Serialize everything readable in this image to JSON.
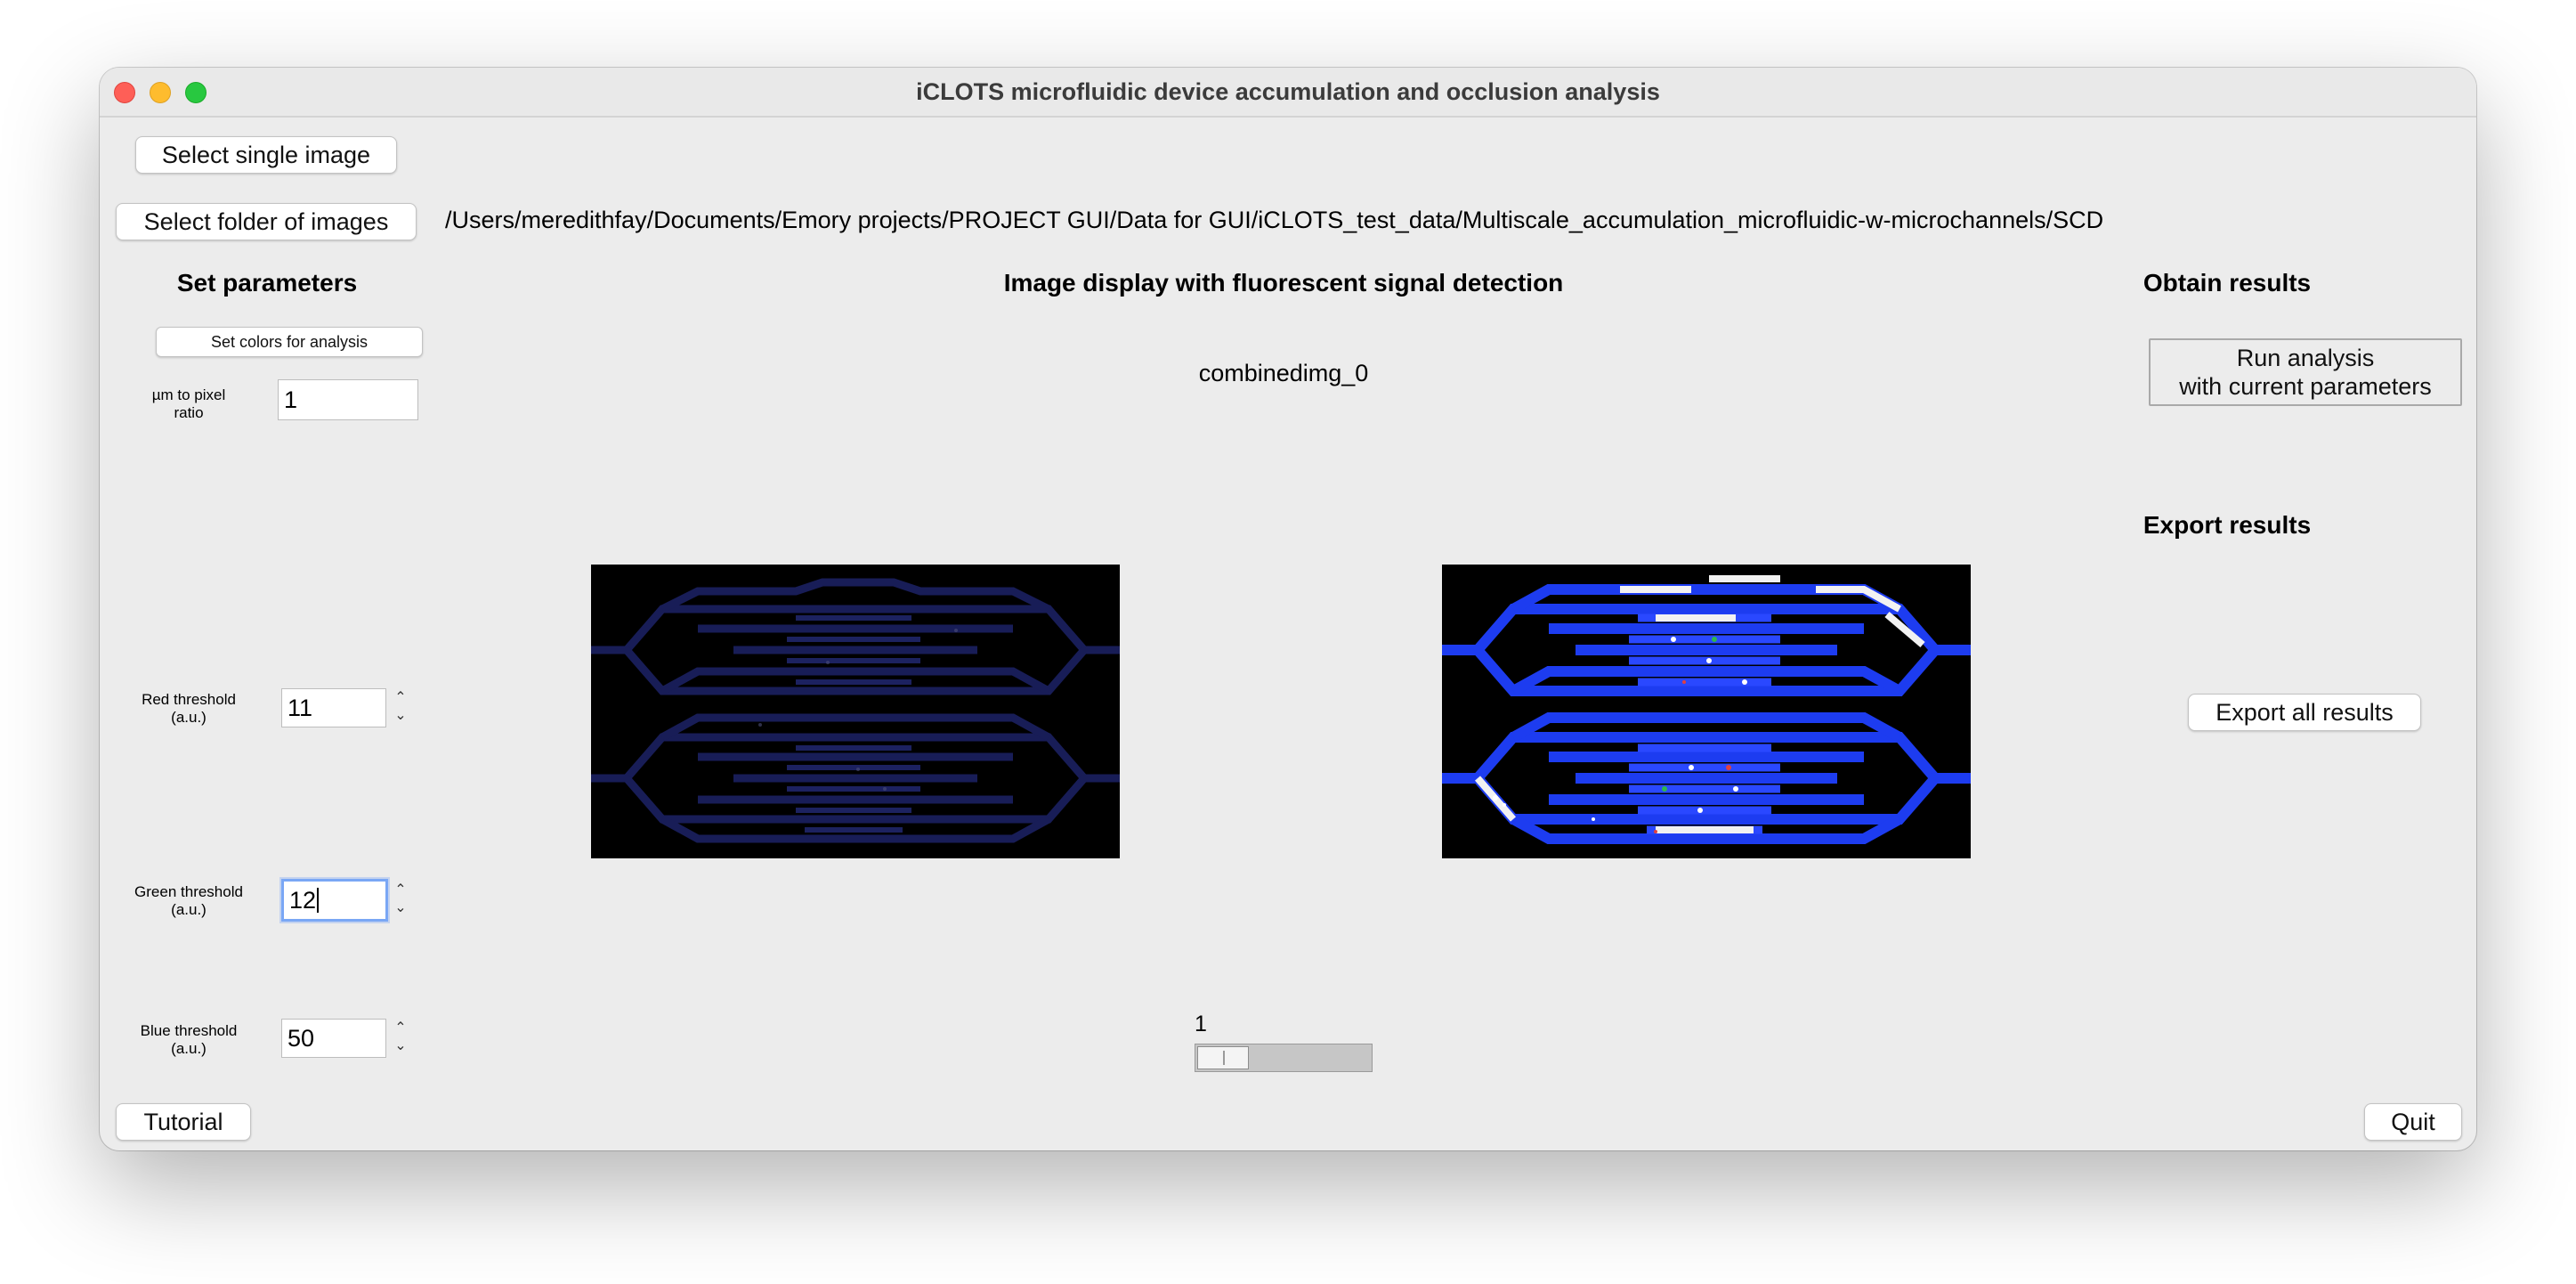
{
  "window": {
    "title": "iCLOTS microfluidic device accumulation and occlusion analysis"
  },
  "toolbar": {
    "select_single_label": "Select single image",
    "select_folder_label": "Select folder of images",
    "folder_path": "/Users/meredithfay/Documents/Emory projects/PROJECT GUI/Data for GUI/iCLOTS_test_data/Multiscale_accumulation_microfluidic-w-microchannels/SCD"
  },
  "parameters": {
    "heading": "Set parameters",
    "set_colors_label": "Set colors for analysis",
    "um_to_pixel": {
      "label_line1": "µm to pixel",
      "label_line2": "ratio",
      "value": "1"
    },
    "red": {
      "label_line1": "Red threshold",
      "label_line2": "(a.u.)",
      "value": "11"
    },
    "green": {
      "label_line1": "Green threshold",
      "label_line2": "(a.u.)",
      "value": "12"
    },
    "blue": {
      "label_line1": "Blue threshold",
      "label_line2": "(a.u.)",
      "value": "50"
    },
    "spin_up_icon": "chevron-up-icon",
    "spin_down_icon": "chevron-down-icon"
  },
  "display": {
    "heading": "Image display with fluorescent signal detection",
    "image_name": "combinedimg_0",
    "slider_value": "1",
    "slider_fraction": 0.0
  },
  "results": {
    "obtain_heading": "Obtain results",
    "run_label_line1": "Run analysis",
    "run_label_line2": "with current parameters",
    "export_heading": "Export results",
    "export_label": "Export all results"
  },
  "footer": {
    "tutorial_label": "Tutorial",
    "quit_label": "Quit"
  },
  "colors": {
    "channel_blue": "#1d3cf0",
    "channel_dim": "#1a1f5c",
    "accumulation_white": "#f2f2f2",
    "focus_ring": "#7aa7f5"
  }
}
